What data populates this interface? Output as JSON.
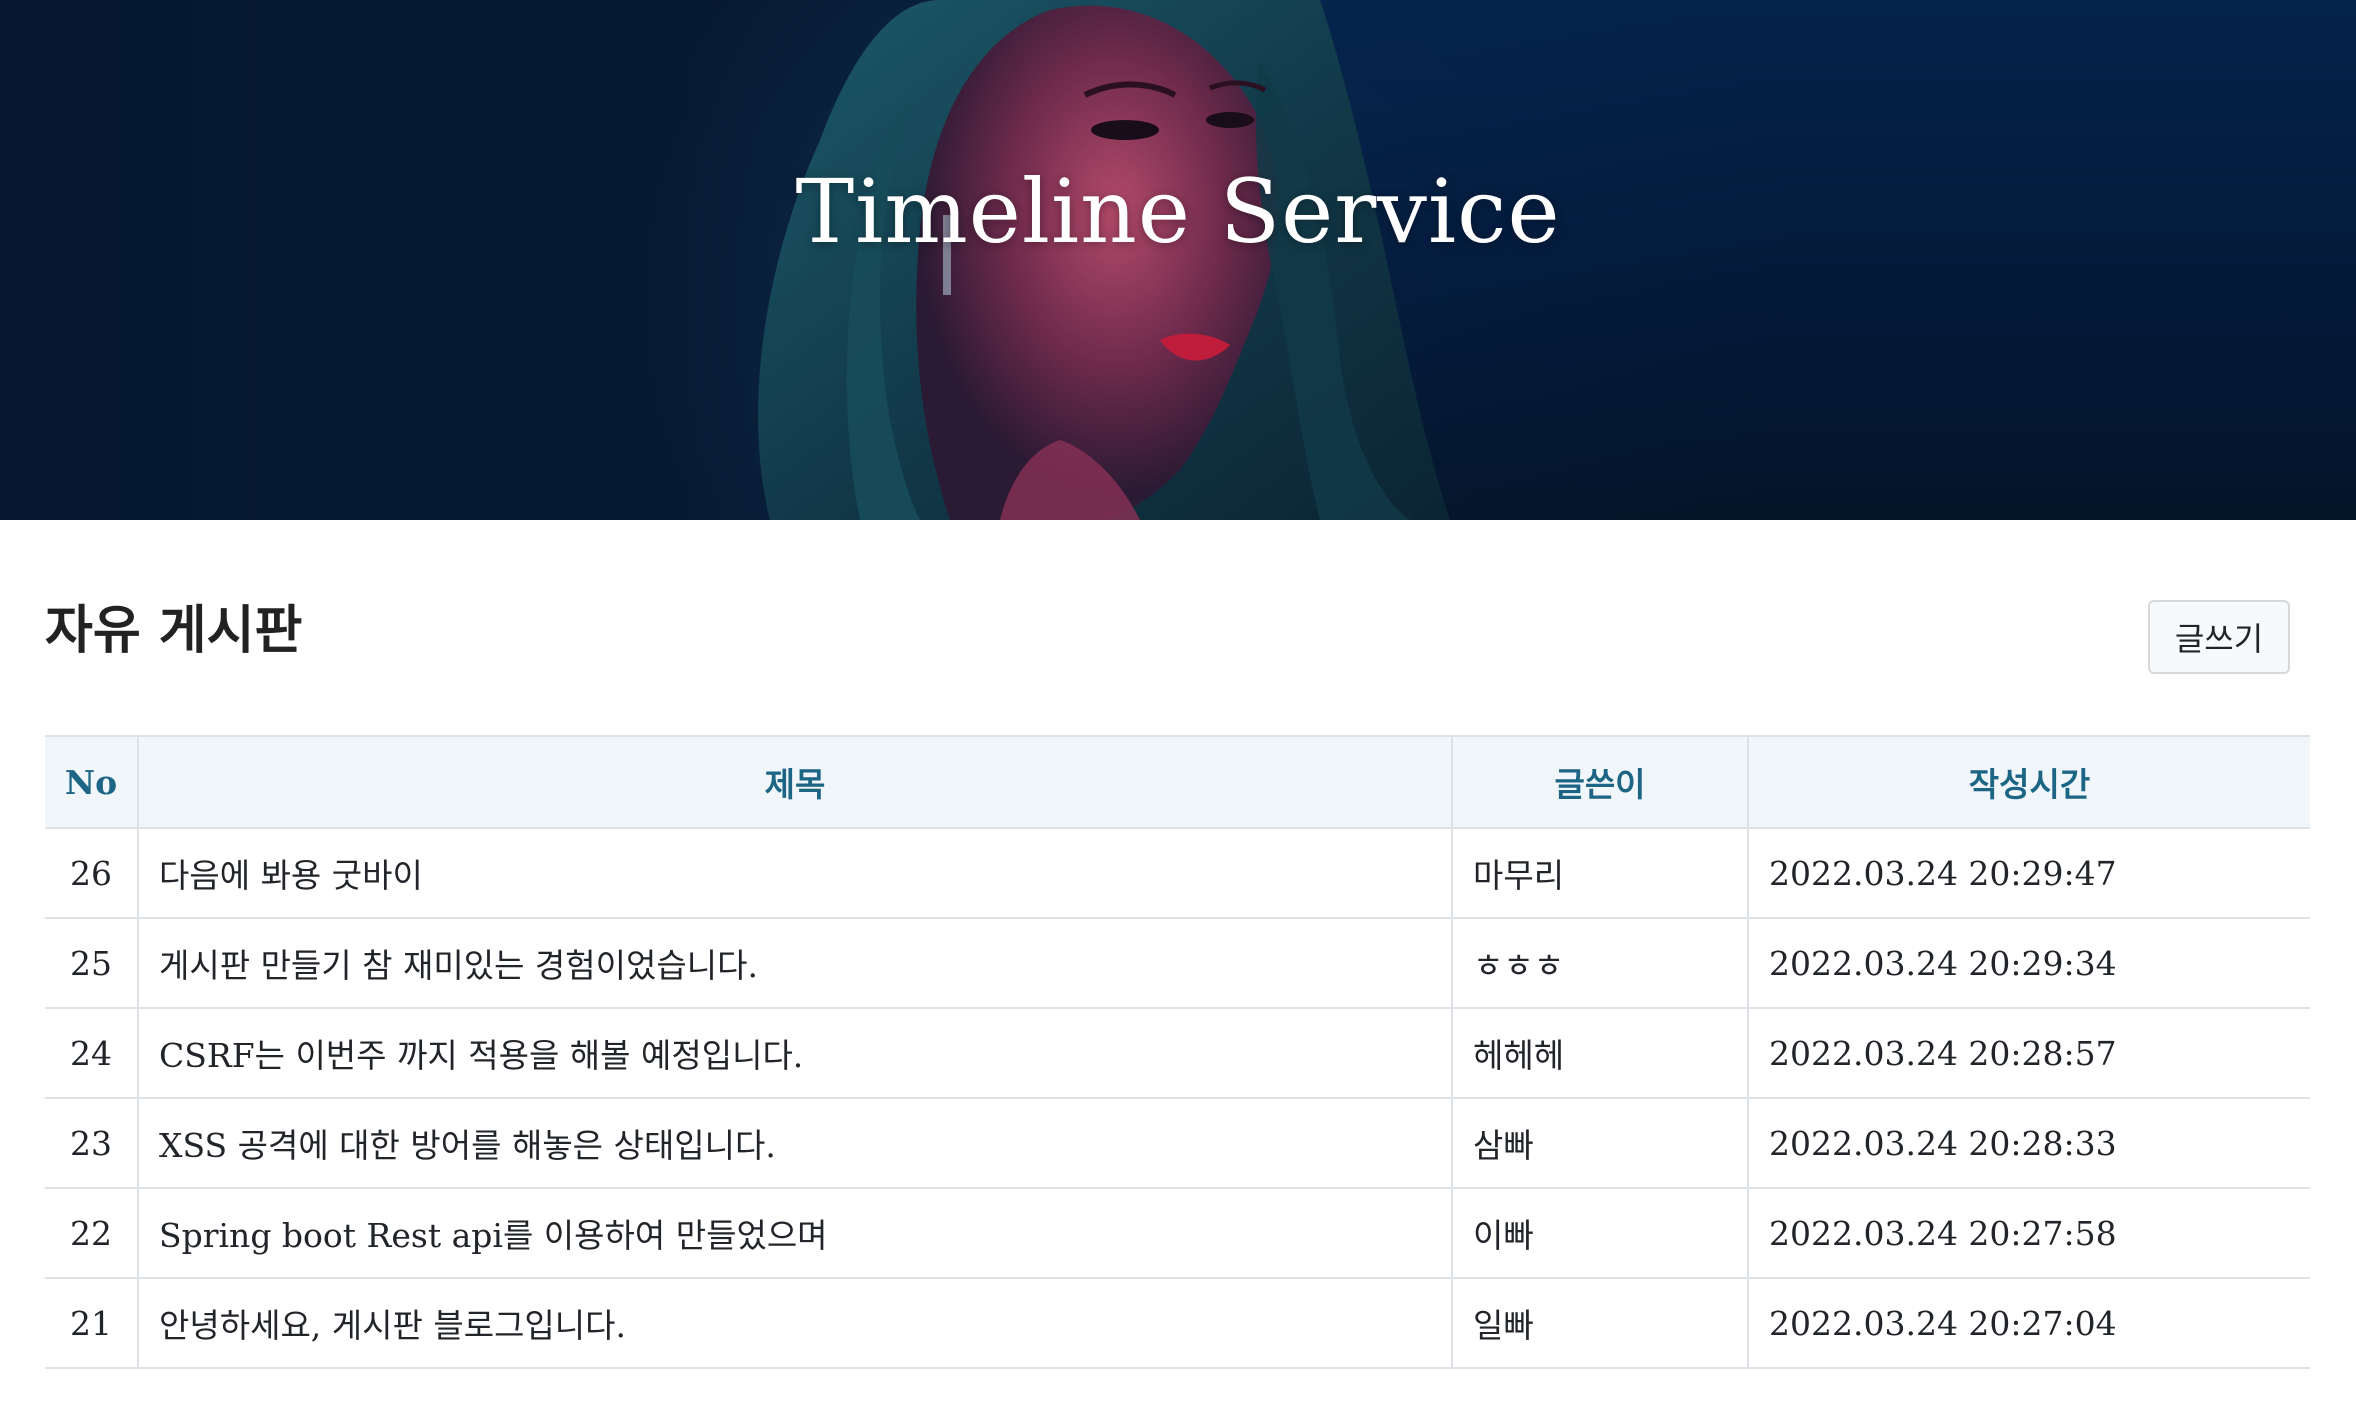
{
  "hero": {
    "title": "Timeline Service"
  },
  "board": {
    "title": "자유 게시판",
    "write_button": "글쓰기",
    "columns": {
      "no": "No",
      "title": "제목",
      "writer": "글쓴이",
      "created": "작성시간"
    },
    "rows": [
      {
        "no": "26",
        "title": "다음에 봐용 굿바이",
        "writer": "마무리",
        "created": "2022.03.24 20:29:47"
      },
      {
        "no": "25",
        "title": "게시판 만들기 참 재미있는 경험이었습니다.",
        "writer": "ㅎㅎㅎ",
        "created": "2022.03.24 20:29:34"
      },
      {
        "no": "24",
        "title": "CSRF는 이번주 까지 적용을 해볼 예정입니다.",
        "writer": "헤헤헤",
        "created": "2022.03.24 20:28:57"
      },
      {
        "no": "23",
        "title": "XSS 공격에 대한 방어를 해놓은 상태입니다.",
        "writer": "삼빠",
        "created": "2022.03.24 20:28:33"
      },
      {
        "no": "22",
        "title": "Spring boot Rest api를 이용하여 만들었으며",
        "writer": "이빠",
        "created": "2022.03.24 20:27:58"
      },
      {
        "no": "21",
        "title": "안녕하세요, 게시판 블로그입니다.",
        "writer": "일빠",
        "created": "2022.03.24 20:27:04"
      }
    ]
  },
  "colors": {
    "header_text": "#1c6585",
    "header_bg": "#f1f6fa",
    "hero_bg": "#06182f"
  }
}
